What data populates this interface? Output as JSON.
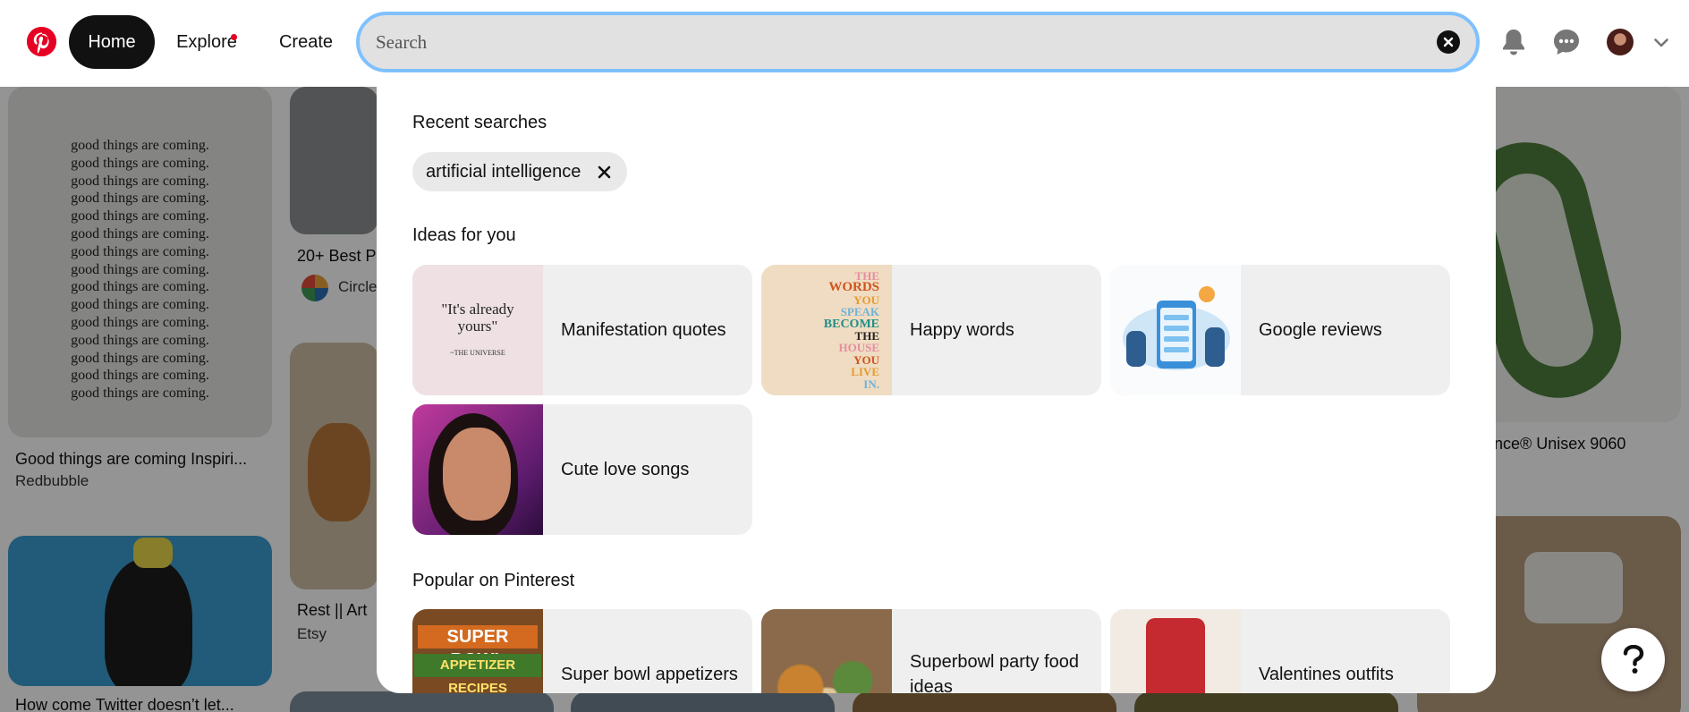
{
  "header": {
    "logo_icon": "pinterest-logo-icon",
    "nav": {
      "home": "Home",
      "explore": "Explore",
      "create": "Create"
    },
    "search": {
      "placeholder": "Search",
      "value": ""
    },
    "icons": [
      "clear-search-icon",
      "bell-icon",
      "chat-icon",
      "chevron-down-icon"
    ],
    "accent_color": "#e60023",
    "focus_color": "#7fc1ff"
  },
  "background_pins": [
    {
      "title": "Good things are coming Inspiri...",
      "source": "Redbubble"
    },
    {
      "title": "20+ Best P",
      "source": "Circle"
    },
    {
      "title": "Rest || Art",
      "source": "Etsy"
    },
    {
      "title": "How come Twitter doesn’t let..."
    },
    {
      "title": "nce® Unisex 9060"
    }
  ],
  "quote_card": {
    "line": "good things are coming.",
    "repeat": 15,
    "lines": [
      "good things are coming.",
      "good things are coming.",
      "good things are coming.",
      "good things are coming.",
      "good things are coming.",
      "good things are coming.",
      "good things are coming.",
      "good things are coming.",
      "good things are coming.",
      "good things are coming.",
      "good things are coming.",
      "good things are coming.",
      "good things are coming.",
      "good things are coming.",
      "good things are coming."
    ]
  },
  "dropdown": {
    "recent_searches_title": "Recent searches",
    "recent_searches": [
      "artificial intelligence"
    ],
    "ideas_title": "Ideas for you",
    "ideas": [
      {
        "label": "Manifestation quotes",
        "thumb_text": "\"It's already yours\"",
        "thumb_sub": "~THE UNIVERSE"
      },
      {
        "label": "Happy words",
        "thumb_lines": [
          "THE",
          "WORDS",
          "YOU",
          "SPEAK",
          "BECOME",
          "THE",
          "HOUSE",
          "YOU",
          "LIVE",
          "IN."
        ]
      },
      {
        "label": "Google reviews"
      },
      {
        "label": "Cute love songs"
      }
    ],
    "popular_title": "Popular on Pinterest",
    "popular": [
      {
        "label": "Super bowl appetizers",
        "thumb_top": "SUPER BOWL",
        "thumb_bottom": "APPETIZER RECIPES"
      },
      {
        "label": "Superbowl party food ideas"
      },
      {
        "label": "Valentines outfits"
      }
    ]
  },
  "help_icon": "question-mark-icon"
}
